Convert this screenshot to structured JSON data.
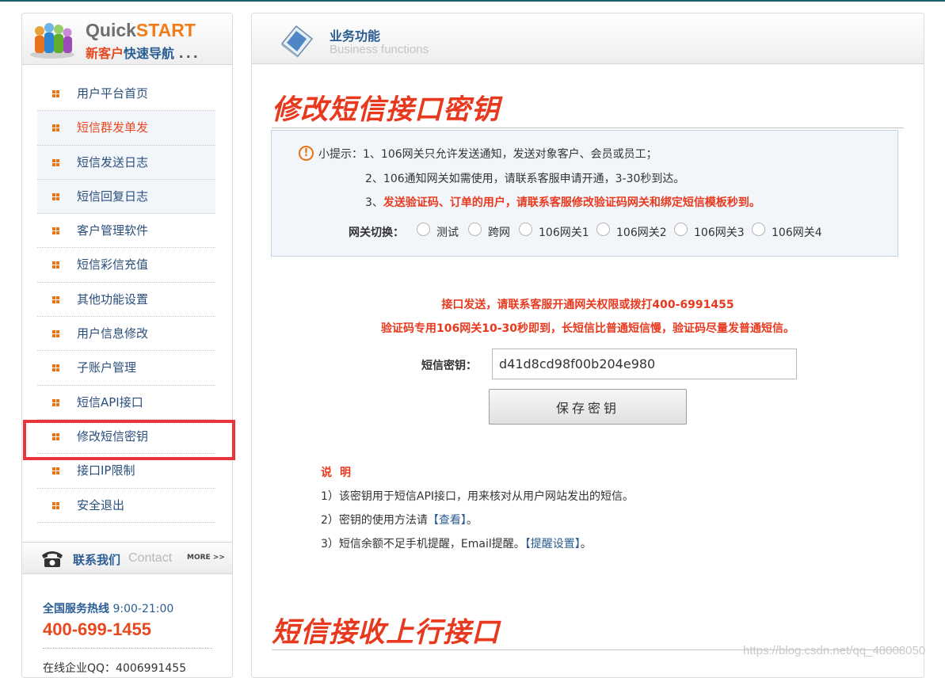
{
  "sidebar": {
    "brand_quick": "Quick",
    "brand_start": "START",
    "sub_new_customer": "新客户",
    "sub_quick_nav": "快速导航",
    "sub_dots": "...",
    "nav": [
      {
        "label": "用户平台首页"
      },
      {
        "label": "短信群发单发"
      },
      {
        "label": "短信发送日志"
      },
      {
        "label": "短信回复日志"
      },
      {
        "label": "客户管理软件"
      },
      {
        "label": "短信彩信充值"
      },
      {
        "label": "其他功能设置"
      },
      {
        "label": "用户信息修改"
      },
      {
        "label": "子账户管理"
      },
      {
        "label": "短信API接口"
      },
      {
        "label": "修改短信密钥"
      },
      {
        "label": "接口IP限制"
      },
      {
        "label": "安全退出"
      }
    ],
    "contact": {
      "title": "联系我们",
      "title_en": "Contact",
      "more": "MORE >>",
      "hotline_label": "全国服务热线",
      "hotline_hours": "9:00-21:00",
      "phone": "400-699-1455",
      "qq_line": "在线企业QQ：4006991455"
    }
  },
  "main": {
    "header_title": "业务功能",
    "header_subtitle": "Business functions",
    "section1_title": "修改短信接口密钥",
    "tips": {
      "icon_glyph": "!",
      "prefix": "小提示：",
      "line1": "1、106网关只允许发送通知，发送对象客户、会员或员工；",
      "line2": "2、106通知网关如需使用，请联系客服申请开通，3-30秒到达。",
      "line3_num": "3、",
      "line3_text": "发送验证码、订单的用户，请联系客服修改验证码网关和绑定短信模板秒到。"
    },
    "gateway": {
      "label": "网关切换：",
      "options": [
        "测试",
        "跨网",
        "106网关1",
        "106网关2",
        "106网关3",
        "106网关4"
      ]
    },
    "notice1": "接口发送，请联系客服开通网关权限或拨打400-6991455",
    "notice2": "验证码专用106网关10-30秒即到，长短信比普通短信慢，验证码尽量发普通短信。",
    "key_label": "短信密钥：",
    "key_value": "d41d8cd98f00b204e980",
    "save_button": "保存密钥",
    "desc_title": "说明",
    "desc": {
      "l1": "1）该密钥用于短信API接口，用来核对从用户网站发出的短信。",
      "l2_pre": "2）密钥的使用方法请",
      "l2_link": "【查看】",
      "l2_post": "。",
      "l3_pre": "3）短信余额不足手机提醒，Email提醒。",
      "l3_link": "【提醒设置】",
      "l3_post": "。"
    },
    "section2_title": "短信接收上行接口"
  },
  "watermark": "https://blog.csdn.net/qq_48008050",
  "colors": {
    "accent_red": "#e8391e",
    "nav_blue": "#2a5d93",
    "bullet_orange": "#e8730f",
    "highlight_red": "#e8343a",
    "tip_bg": "#f2f6fb"
  }
}
